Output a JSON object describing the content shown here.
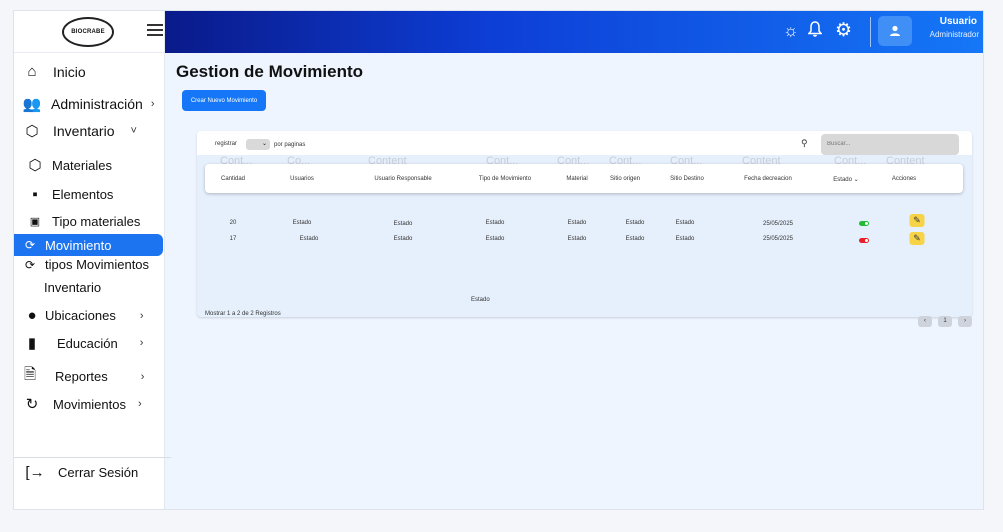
{
  "sidebar": {
    "logo_text": "BIOCRABE",
    "items": [
      {
        "label": "Inicio",
        "icon": "home-icon",
        "chevron": ""
      },
      {
        "label": "Administración",
        "icon": "users-icon",
        "chevron": "›"
      },
      {
        "label": "Inventario",
        "icon": "box-icon",
        "chevron": "˅"
      },
      {
        "label": "Materiales",
        "icon": "cube-icon",
        "chevron": ""
      },
      {
        "label": "Elementos",
        "icon": "grid-icon",
        "chevron": ""
      },
      {
        "label": "Tipo materiales",
        "icon": "image-icon",
        "chevron": ""
      },
      {
        "label": "Movimiento",
        "icon": "sync-icon",
        "chevron": ""
      },
      {
        "label": "tipos Movimientos",
        "icon": "sync-icon",
        "chevron": ""
      },
      {
        "label": "Inventario",
        "icon": "",
        "chevron": ""
      },
      {
        "label": "Ubicaciones",
        "icon": "location-pin-icon",
        "chevron": "›"
      },
      {
        "label": "Educación",
        "icon": "book-icon",
        "chevron": "›"
      },
      {
        "label": "Reportes",
        "icon": "document-icon",
        "chevron": "›"
      },
      {
        "label": "Movimientos",
        "icon": "refresh-icon",
        "chevron": "›"
      }
    ],
    "logout_label": "Cerrar Sesión"
  },
  "header": {
    "user_name": "Usuario",
    "user_role": "Administrador"
  },
  "main": {
    "title": "Gestion de Movimiento",
    "create_button": "Crear Nuevo Movimiento",
    "registrar_label": "registrar",
    "por_paginas_label": "por paginas",
    "search_placeholder": "Buscar...",
    "ghost_labels": [
      "Cont...",
      "Co...",
      "Content",
      "Cont...",
      "Cont...",
      "Cont...",
      "Cont...",
      "Content",
      "Cont...",
      "Content"
    ],
    "columns": [
      "Cantidad",
      "Usuarios",
      "Usuario Responsable",
      "Tipo de Movimiento",
      "Material",
      "Sitio origen",
      "Sitio Destino",
      "Fecha decreacion",
      "Estado",
      "Acciones"
    ],
    "rows": [
      {
        "cantidad": "20",
        "usuarios": "Estado",
        "responsable": "Estado",
        "tipo": "Estado",
        "material": "Estado",
        "origen": "Estado",
        "destino": "Estado",
        "fecha": "25/05/2025",
        "estado_color": "#22bb33"
      },
      {
        "cantidad": "17",
        "usuarios": "Estado",
        "responsable": "Estado",
        "tipo": "Estado",
        "material": "Estado",
        "origen": "Estado",
        "destino": "Estado",
        "fecha": "25/05/2025",
        "estado_color": "#e8202a"
      }
    ],
    "footer_estado": "Estado",
    "footer_info": "Mostrar 1 a 2 de 2 Registros",
    "pager": {
      "prev": "‹",
      "page": "1",
      "next": "›"
    }
  }
}
